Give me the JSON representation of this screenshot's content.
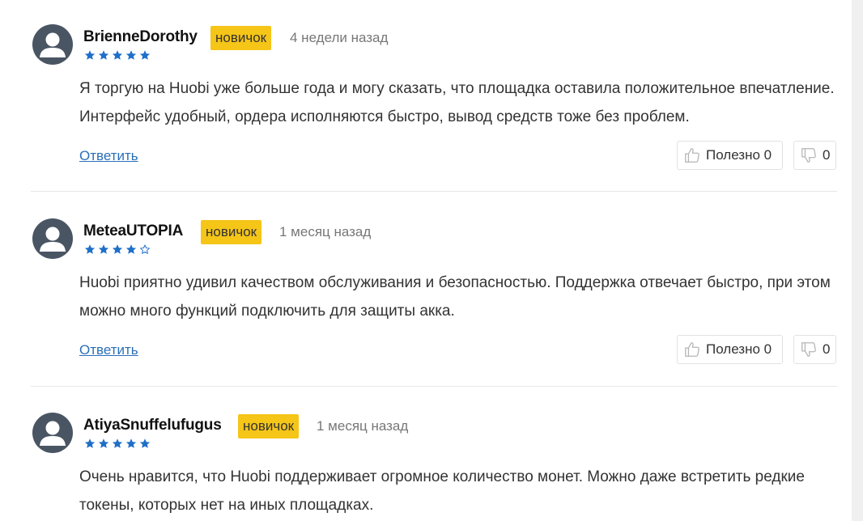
{
  "reviews": [
    {
      "author": "BrienneDorothy",
      "badge": "новичок",
      "time": "4 недели назад",
      "rating": 5,
      "text": "Я торгую на Huobi уже больше года и могу сказать, что площадка оставила положительное впечатление. Интерфейс удобный, ордера исполняются быстро, вывод средств тоже без проблем.",
      "reply": "Ответить",
      "useful": "Полезно 0",
      "dislike": "0"
    },
    {
      "author": "MeteaUTOPIA",
      "badge": "новичок",
      "time": "1 месяц назад",
      "rating": 4,
      "text": "Huobi приятно удивил качеством обслуживания и безопасностью. Поддержка отвечает быстро, при этом можно много функций подключить для защиты акка.",
      "reply": "Ответить",
      "useful": "Полезно 0",
      "dislike": "0"
    },
    {
      "author": "AtiyaSnuffelufugus",
      "badge": "новичок",
      "time": "1 месяц назад",
      "rating": 5,
      "text": "Очень нравится, что Huobi поддерживает огромное количество монет. Можно даже встретить редкие токены, которых нет на иных площадках."
    }
  ],
  "colors": {
    "badge": "#f5c518",
    "star": "#1f6fc9",
    "link": "#2a6fb8",
    "avatar": "#4a5563"
  },
  "icons": {
    "avatar": "user-avatar-icon",
    "star": "star-icon",
    "like": "thumbs-up-icon",
    "dislike": "thumbs-down-icon"
  }
}
